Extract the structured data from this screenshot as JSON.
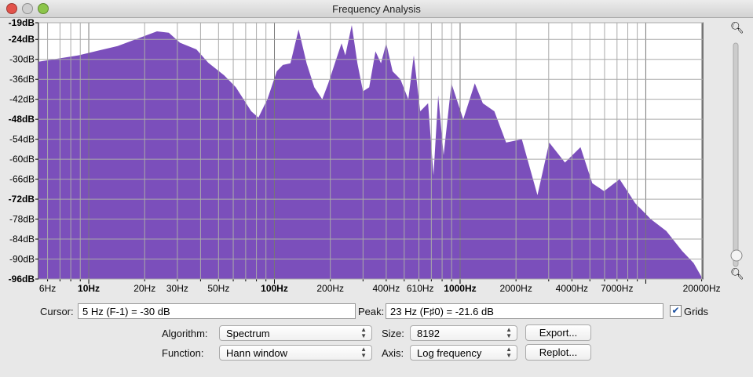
{
  "window": {
    "title": "Frequency Analysis"
  },
  "chart_data": {
    "type": "area",
    "xscale": "log",
    "xlim": [
      5.36,
      20270
    ],
    "ylim": [
      -96,
      -19
    ],
    "ytick_labels": [
      "-19dB",
      "-24dB",
      "-30dB",
      "-36dB",
      "-42dB",
      "-48dB",
      "-54dB",
      "-60dB",
      "-66dB",
      "-72dB",
      "-78dB",
      "-84dB",
      "-90dB",
      "-96dB"
    ],
    "yticks": [
      -19,
      -24,
      -30,
      -36,
      -42,
      -48,
      -54,
      -60,
      -66,
      -72,
      -78,
      -84,
      -90,
      -96
    ],
    "xtick_labels": [
      "6Hz",
      "10Hz",
      "20Hz",
      "30Hz",
      "50Hz",
      "100Hz",
      "200Hz",
      "400Hz",
      "610Hz",
      "1000Hz",
      "2000Hz",
      "4000Hz",
      "7000Hz",
      "20000Hz"
    ],
    "xticks": [
      6,
      10,
      20,
      30,
      50,
      100,
      200,
      400,
      610,
      1000,
      2000,
      4000,
      7000,
      20000
    ],
    "grid": true,
    "color": "#7b4fbb",
    "points": [
      [
        5.36,
        -30.7
      ],
      [
        8.8,
        -28.8
      ],
      [
        14.3,
        -26
      ],
      [
        23.3,
        -21.6
      ],
      [
        27,
        -22
      ],
      [
        31,
        -25
      ],
      [
        38,
        -27
      ],
      [
        44,
        -31
      ],
      [
        53.6,
        -34.8
      ],
      [
        62,
        -38.4
      ],
      [
        75,
        -45.6
      ],
      [
        82,
        -47.5
      ],
      [
        91.6,
        -42
      ],
      [
        103,
        -33.6
      ],
      [
        111,
        -31.7
      ],
      [
        122,
        -31.2
      ],
      [
        135,
        -21
      ],
      [
        149,
        -31.2
      ],
      [
        164,
        -38.4
      ],
      [
        181,
        -42
      ],
      [
        195,
        -37.2
      ],
      [
        215,
        -30
      ],
      [
        230,
        -25.2
      ],
      [
        241,
        -28.8
      ],
      [
        261,
        -19.7
      ],
      [
        280,
        -31.2
      ],
      [
        300,
        -39.6
      ],
      [
        324,
        -38.4
      ],
      [
        350,
        -27.6
      ],
      [
        375,
        -31.2
      ],
      [
        400,
        -25.2
      ],
      [
        433,
        -33.6
      ],
      [
        477,
        -36
      ],
      [
        526,
        -42
      ],
      [
        563,
        -28.8
      ],
      [
        610,
        -45.6
      ],
      [
        672,
        -43.2
      ],
      [
        719,
        -64.8
      ],
      [
        762,
        -40.8
      ],
      [
        815,
        -58.8
      ],
      [
        898,
        -37.2
      ],
      [
        1040,
        -48
      ],
      [
        1200,
        -37.2
      ],
      [
        1325,
        -43.2
      ],
      [
        1530,
        -45.6
      ],
      [
        1770,
        -55
      ],
      [
        2150,
        -54
      ],
      [
        2610,
        -70.8
      ],
      [
        3020,
        -55
      ],
      [
        3670,
        -61
      ],
      [
        4450,
        -56.4
      ],
      [
        5150,
        -67.2
      ],
      [
        5960,
        -69.6
      ],
      [
        7230,
        -66
      ],
      [
        8770,
        -73.2
      ],
      [
        10650,
        -78
      ],
      [
        12900,
        -81.6
      ],
      [
        15700,
        -87.6
      ],
      [
        18100,
        -91.2
      ],
      [
        20270,
        -96
      ]
    ]
  },
  "controls": {
    "cursor_label": "Cursor:",
    "cursor_value": "5 Hz (F-1) = -30 dB",
    "peak_label": "Peak:",
    "peak_value": "23 Hz (F♯0) = -21.6 dB",
    "grids_label": "Grids",
    "grids_checked": true,
    "algorithm_label": "Algorithm:",
    "algorithm_value": "Spectrum",
    "size_label": "Size:",
    "size_value": "8192",
    "function_label": "Function:",
    "function_value": "Hann window",
    "axis_label": "Axis:",
    "axis_value": "Log frequency",
    "export_label": "Export...",
    "replot_label": "Replot..."
  }
}
